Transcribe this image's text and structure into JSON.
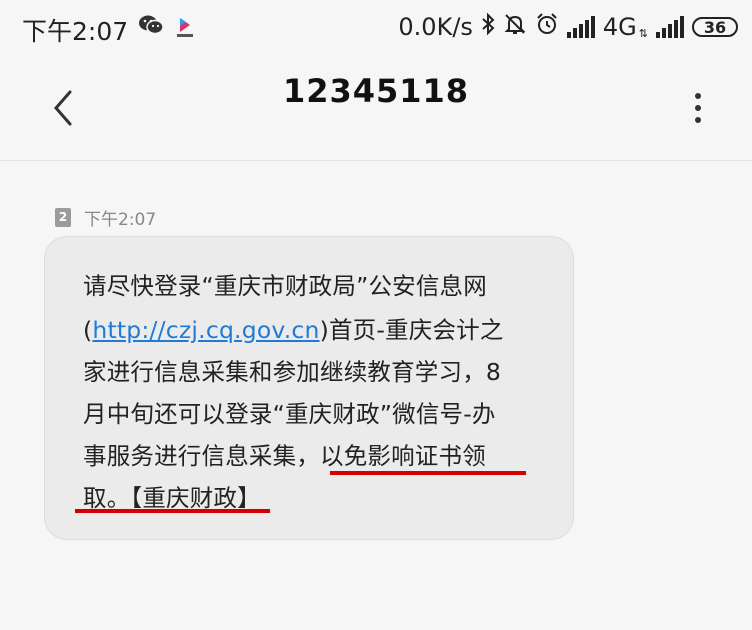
{
  "status_bar": {
    "time": "下午2:07",
    "net_speed": "0.0K/s",
    "network_type": "4G",
    "battery": "36",
    "icons": [
      "wechat-icon",
      "app-icon",
      "bluetooth-icon",
      "mute-icon",
      "alarm-icon",
      "signal-icon",
      "signal-icon-2",
      "battery-icon"
    ]
  },
  "header": {
    "title": "12345118",
    "back_icon": "back-chevron-icon",
    "more_icon": "more-vert-icon"
  },
  "message": {
    "sim_slot": "2",
    "time": "下午2:07",
    "lines": {
      "l1": "请尽快登录“重庆市财政局”公安信息网",
      "l2_open": "(",
      "l2_link": "http://czj.cq.gov.cn",
      "l2_rest": ")首页-重庆会计之",
      "l3": "家进行信息采集和参加继续教育学习，8",
      "l4": "月中旬还可以登录“重庆财政”微信号-办",
      "l5": "事服务进行信息采集，以免影响证书领",
      "l6": "取。【重庆财政】"
    },
    "highlight_color": "#d40000",
    "link_color": "#1e7bd7"
  }
}
